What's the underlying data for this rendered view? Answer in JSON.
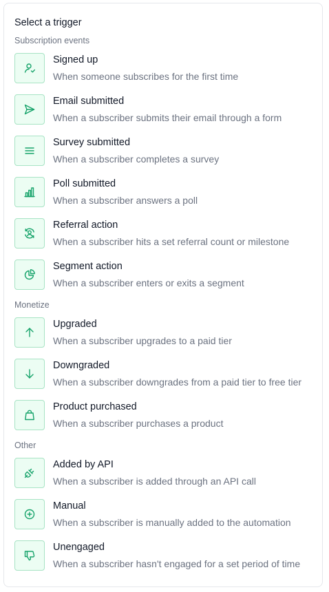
{
  "title": "Select a trigger",
  "colors": {
    "accent": "#16a36a",
    "icon_bg": "#ecfdf3",
    "icon_border": "#a7e3c4",
    "muted_text": "#6b7280"
  },
  "sections": [
    {
      "label": "Subscription events",
      "items": [
        {
          "title": "Signed up",
          "desc": "When someone subscribes for the first time",
          "icon": "user-check-icon"
        },
        {
          "title": "Email submitted",
          "desc": "When a subscriber submits their email through a form",
          "icon": "send-icon"
        },
        {
          "title": "Survey submitted",
          "desc": "When a subscriber completes a survey",
          "icon": "list-icon"
        },
        {
          "title": "Poll submitted",
          "desc": "When a subscriber answers a poll",
          "icon": "bar-chart-icon"
        },
        {
          "title": "Referral action",
          "desc": "When a subscriber hits a set referral count or milestone",
          "icon": "user-refresh-icon"
        },
        {
          "title": "Segment action",
          "desc": "When a subscriber enters or exits a segment",
          "icon": "pie-chart-icon"
        }
      ]
    },
    {
      "label": "Monetize",
      "items": [
        {
          "title": "Upgraded",
          "desc": "When a subscriber upgrades to a paid tier",
          "icon": "arrow-up-icon"
        },
        {
          "title": "Downgraded",
          "desc": "When a subscriber downgrades from a paid tier to free tier",
          "icon": "arrow-down-icon"
        },
        {
          "title": "Product purchased",
          "desc": "When a subscriber purchases a product",
          "icon": "shopping-bag-icon"
        }
      ]
    },
    {
      "label": "Other",
      "items": [
        {
          "title": "Added by API",
          "desc": "When a subscriber is added through an API call",
          "icon": "plug-icon"
        },
        {
          "title": "Manual",
          "desc": "When a subscriber is manually added to the automation",
          "icon": "plus-circle-icon"
        },
        {
          "title": "Unengaged",
          "desc": "When a subscriber hasn't engaged for a set period of time",
          "icon": "thumbs-down-icon"
        }
      ]
    }
  ]
}
